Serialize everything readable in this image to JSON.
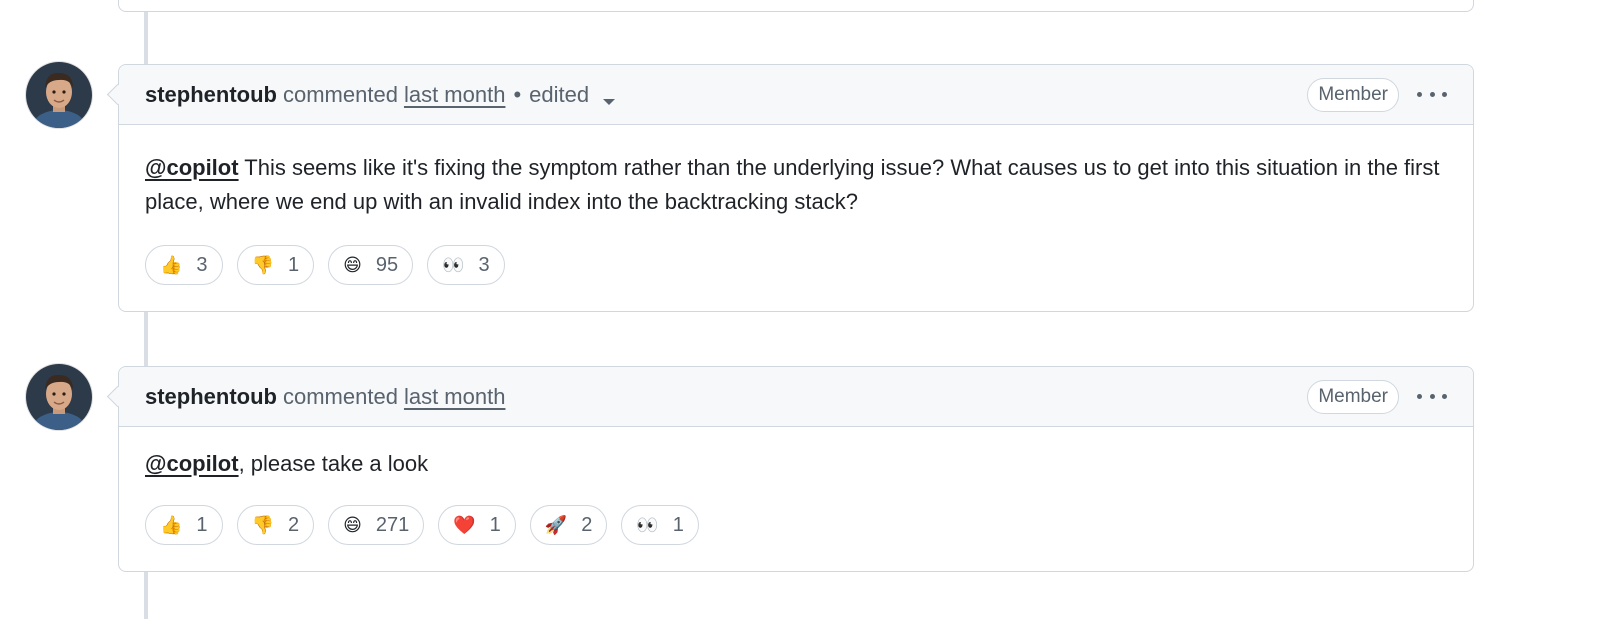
{
  "comments": [
    {
      "author": "stephentoub",
      "action": "commented",
      "time": "last month",
      "separator": "•",
      "edited": "edited",
      "badge": "Member",
      "mention": "@copilot",
      "text": " This seems like it's fixing the symptom rather than the underlying issue? What causes us to get into this situation in the first place, where we end up with an invalid index into the backtracking stack?",
      "reactions": [
        {
          "emoji": "👍",
          "icon": "thumbs-up-icon",
          "count": "3"
        },
        {
          "emoji": "👎",
          "icon": "thumbs-down-icon",
          "count": "1"
        },
        {
          "emoji": "😄",
          "icon": "laugh-icon",
          "count": "95"
        },
        {
          "emoji": "👀",
          "icon": "eyes-icon",
          "count": "3"
        }
      ]
    },
    {
      "author": "stephentoub",
      "action": "commented",
      "time": "last month",
      "badge": "Member",
      "mention": "@copilot",
      "text": ", please take a look",
      "reactions": [
        {
          "emoji": "👍",
          "icon": "thumbs-up-icon",
          "count": "1"
        },
        {
          "emoji": "👎",
          "icon": "thumbs-down-icon",
          "count": "2"
        },
        {
          "emoji": "😄",
          "icon": "laugh-icon",
          "count": "271"
        },
        {
          "emoji": "❤️",
          "icon": "heart-icon",
          "count": "1"
        },
        {
          "emoji": "🚀",
          "icon": "rocket-icon",
          "count": "2"
        },
        {
          "emoji": "👀",
          "icon": "eyes-icon",
          "count": "1"
        }
      ]
    }
  ],
  "colors": {
    "border": "#d0d7de",
    "header_bg": "#f6f8fa",
    "muted": "#59636e",
    "text": "#1f2328"
  }
}
